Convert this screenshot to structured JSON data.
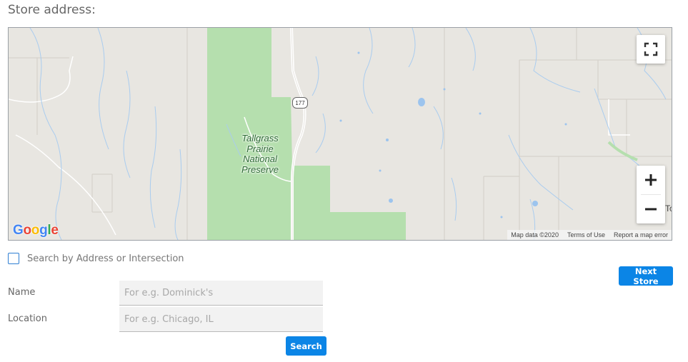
{
  "section_title": "Store address:",
  "map": {
    "park_label_lines": [
      "Tallgrass",
      "Prairie",
      "National",
      "Preserve"
    ],
    "route_shield": "177",
    "edge_label": "To",
    "google_logo": "Google",
    "attribution": {
      "map_data": "Map data ©2020",
      "terms": "Terms of Use",
      "report": "Report a map error"
    },
    "zoom_in_icon": "plus-icon",
    "zoom_out_icon": "minus-icon",
    "fullscreen_icon": "fullscreen-icon"
  },
  "search_toggle_label": "Search by Address or Intersection",
  "next_store_label": "Next Store",
  "form": {
    "name_label": "Name",
    "name_placeholder": "For e.g. Dominick's",
    "location_label": "Location",
    "location_placeholder": "For e.g. Chicago, IL",
    "search_label": "Search"
  },
  "colors": {
    "accent": "#0b85e6",
    "park_green": "#b5dfae",
    "map_bg": "#e8e6e1",
    "checkbox_border": "#2f7fd3"
  }
}
